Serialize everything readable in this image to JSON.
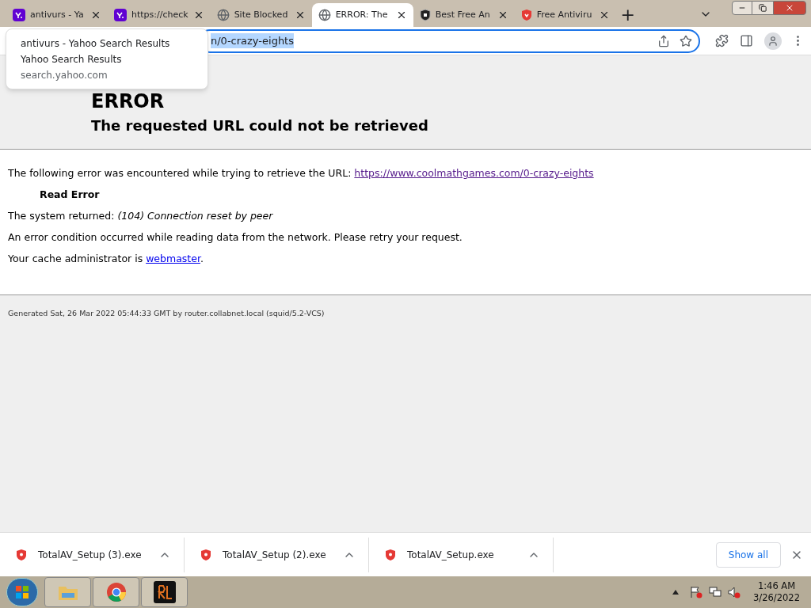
{
  "tabs": [
    {
      "title": "antivurs - Ya",
      "kind": "yahoo",
      "selected": false
    },
    {
      "title": "https://check",
      "kind": "yahoo",
      "selected": false
    },
    {
      "title": "Site Blocked",
      "kind": "globe",
      "selected": false
    },
    {
      "title": "ERROR: The",
      "kind": "globe",
      "selected": true
    },
    {
      "title": "Best Free An",
      "kind": "shield-dark",
      "selected": false
    },
    {
      "title": "Free Antiviru",
      "kind": "shield-red",
      "selected": false
    }
  ],
  "new_tab": "+",
  "address_bar": {
    "url": "n/0-crazy-eights"
  },
  "tooltip": {
    "title": "antivurs - Yahoo Search Results",
    "subtitle": "Yahoo Search Results",
    "domain": "search.yahoo.com"
  },
  "page": {
    "heading": "ERROR",
    "subheading": "The requested URL could not be retrieved",
    "intro": "The following error was encountered while trying to retrieve the URL:",
    "intro_link": "https://www.coolmathgames.com/0-crazy-eights",
    "error_name": "Read Error",
    "system_prefix": "The system returned:",
    "system_message": "(104) Connection reset by peer",
    "description": "An error condition occurred while reading data from the network. Please retry your request.",
    "admin_prefix": "Your cache administrator is",
    "admin_link": "webmaster",
    "admin_suffix": ".",
    "footer": "Generated Sat, 26 Mar 2022 05:44:33 GMT by router.collabnet.local (squid/5.2-VCS)"
  },
  "downloads": [
    {
      "name": "TotalAV_Setup (3).exe"
    },
    {
      "name": "TotalAV_Setup (2).exe"
    },
    {
      "name": "TotalAV_Setup.exe"
    }
  ],
  "show_all": "Show all",
  "taskbar": {
    "time": "1:46 AM",
    "date": "3/26/2022"
  }
}
